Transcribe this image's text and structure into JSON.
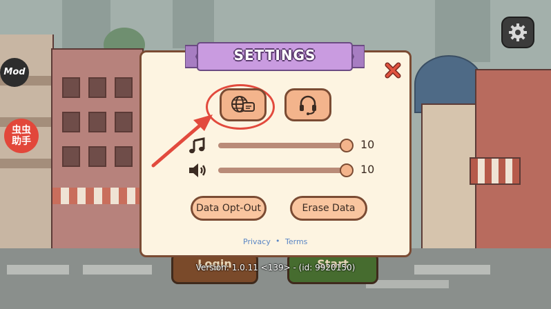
{
  "app": {
    "side_mod_label": "Mod",
    "side_bug_label": "虫虫\n助手"
  },
  "settings": {
    "title": "SETTINGS",
    "music_volume": 10,
    "sfx_volume": 10,
    "music_volume_fraction": 1.0,
    "sfx_volume_fraction": 1.0,
    "buttons": {
      "data_opt_out": "Data Opt-Out",
      "erase_data": "Erase Data"
    },
    "links": {
      "privacy": "Privacy",
      "separator": "•",
      "terms": "Terms"
    },
    "icons": {
      "language": "globe-chat-icon",
      "support": "headset-icon",
      "music": "music-note-icon",
      "sfx": "speaker-icon",
      "close": "close-icon"
    }
  },
  "game": {
    "login_label": "Login",
    "start_label": "Start"
  },
  "footer": {
    "version": "Version: 1.0.11 <139> - (id: 9920150)"
  },
  "colors": {
    "panel_bg": "#fdf4e1",
    "ribbon": "#c99be0",
    "accent_button": "#f3b48c",
    "highlight": "#e24a3d",
    "close": "#e0523f",
    "link": "#5a86c5"
  }
}
